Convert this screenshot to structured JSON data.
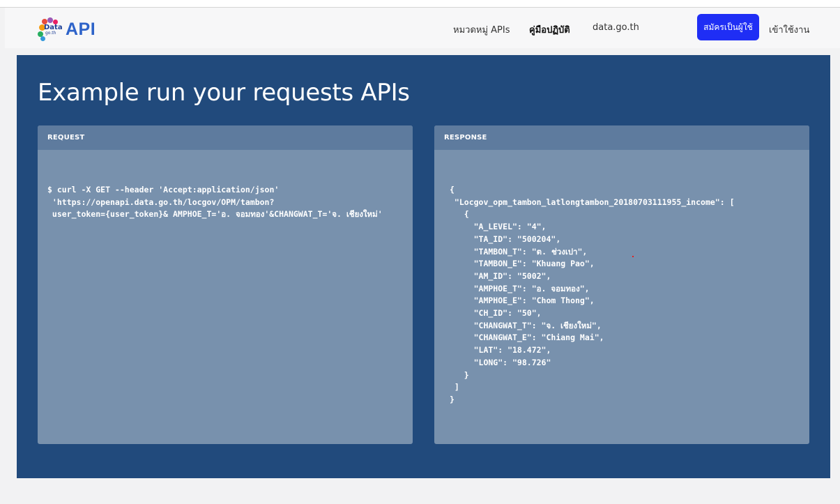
{
  "brand": {
    "logo_word": "Data",
    "logo_sub": "go.th",
    "title": "API"
  },
  "nav": {
    "items": [
      {
        "label": "หมวดหมู่ APIs",
        "active": false
      },
      {
        "label": "คู่มือปฏิบัติ",
        "active": true
      },
      {
        "label": "data.go.th",
        "active": false
      }
    ],
    "signup_label": "สมัครเป็นผู้ใช้",
    "login_label": "เข้าใช้งาน"
  },
  "colors": {
    "hero_bg": "#214a7c",
    "panel_bg": "#7891ad",
    "panel_head_bg": "#5e7b9e",
    "signup_bg": "#1f2ef5",
    "brand": "#2e63c9"
  },
  "page": {
    "title": "Example run your requests APIs"
  },
  "request": {
    "heading": "REQUEST",
    "code": "$ curl -X GET --header 'Accept:application/json'\n 'https://openapi.data.go.th/locgov/OPM/tambon?\n user_token={user_token}& AMPHOE_T='อ. จอมทอง'&CHANGWAT_T='จ. เชียงใหม่'"
  },
  "response": {
    "heading": "RESPONSE",
    "code": "{\n \"Locgov_opm_tambon_latlongtambon_20180703111955_income\": [\n   {\n     \"A_LEVEL\": \"4\",\n     \"TA_ID\": \"500204\",\n     \"TAMBON_T\": \"ต. ช่วงเปา\",\n     \"TAMBON_E\": \"Khuang Pao\",\n     \"AM_ID\": \"5002\",\n     \"AMPHOE_T\": \"อ. จอมทอง\",\n     \"AMPHOE_E\": \"Chom Thong\",\n     \"CH_ID\": \"50\",\n     \"CHANGWAT_T\": \"จ. เชียงใหม่\",\n     \"CHANGWAT_E\": \"Chiang Mai\",\n     \"LAT\": \"18.472\",\n     \"LONG\": \"98.726\"\n   }\n ]\n}"
  }
}
